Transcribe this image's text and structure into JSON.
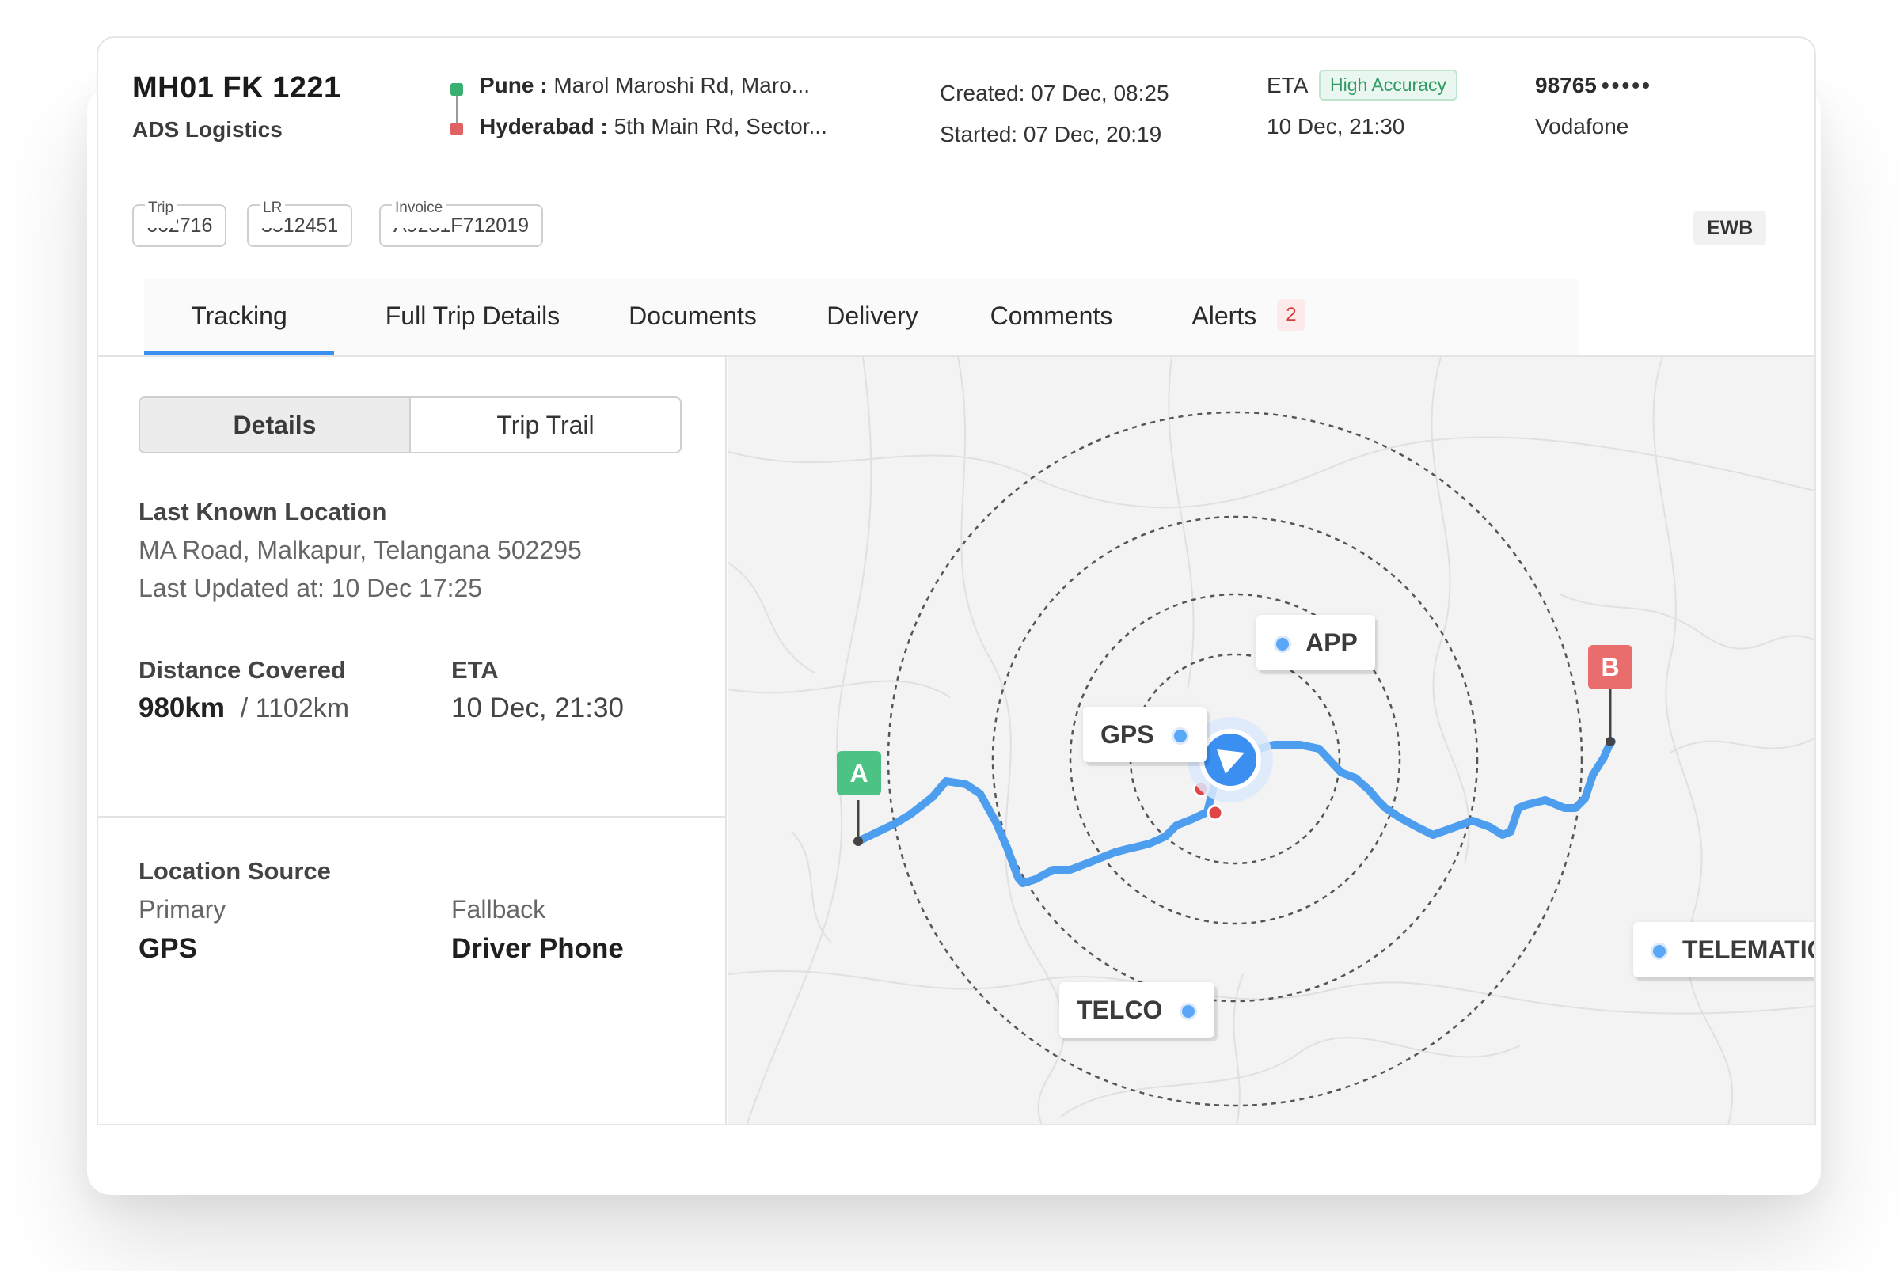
{
  "vehicle": {
    "number": "MH01 FK 1221",
    "company": "ADS Logistics"
  },
  "route": {
    "origin_city": "Pune :",
    "origin_address": "Marol Maroshi Rd, Maro...",
    "dest_city": "Hyderabad :",
    "dest_address": "5th Main Rd, Sector..."
  },
  "times": {
    "created": "Created: 07 Dec, 08:25",
    "started": "Started:  07 Dec, 20:19"
  },
  "eta": {
    "label": "ETA",
    "badge": "High Accuracy",
    "value": "10 Dec, 21:30"
  },
  "contact": {
    "phone": "98765",
    "mask": "•••••",
    "operator": "Vodafone"
  },
  "chips": [
    {
      "caption": "Trip",
      "value": "662716"
    },
    {
      "caption": "LR",
      "value": "3512451"
    },
    {
      "caption": "Invoice",
      "value": "A9281F712019"
    }
  ],
  "ewb_label": "EWB",
  "tabs": [
    {
      "label": "Tracking",
      "active": true
    },
    {
      "label": "Full Trip Details"
    },
    {
      "label": "Documents"
    },
    {
      "label": "Delivery"
    },
    {
      "label": "Comments"
    },
    {
      "label": "Alerts",
      "count": "2"
    }
  ],
  "segment": {
    "details": "Details",
    "trip_trail": "Trip Trail"
  },
  "last_location": {
    "title": "Last Known Location",
    "address": "MA Road, Malkapur, Telangana 502295",
    "updated": "Last Updated at: 10 Dec 17:25"
  },
  "distance": {
    "title": "Distance Covered",
    "covered": "980",
    "unit": "km",
    "total": "/ 1102",
    "total_unit": "km"
  },
  "panel_eta": {
    "title": "ETA",
    "value": "10 Dec, 21:30"
  },
  "location_source": {
    "title": "Location Source",
    "primary_label": "Primary",
    "primary_value": "GPS",
    "fallback_label": "Fallback",
    "fallback_value": "Driver Phone"
  },
  "map": {
    "start": "A",
    "end": "B",
    "sources": {
      "app": "APP",
      "gps": "GPS",
      "telco": "TELCO",
      "telematics": "TELEMATICS"
    }
  },
  "colors": {
    "accent": "#3b8ff0",
    "route": "#58a8f5",
    "start_flag": "#4cc285",
    "end_flag": "#ea6d6d",
    "badge_green": "#2f9a64",
    "alert_red": "#d63c3c"
  }
}
